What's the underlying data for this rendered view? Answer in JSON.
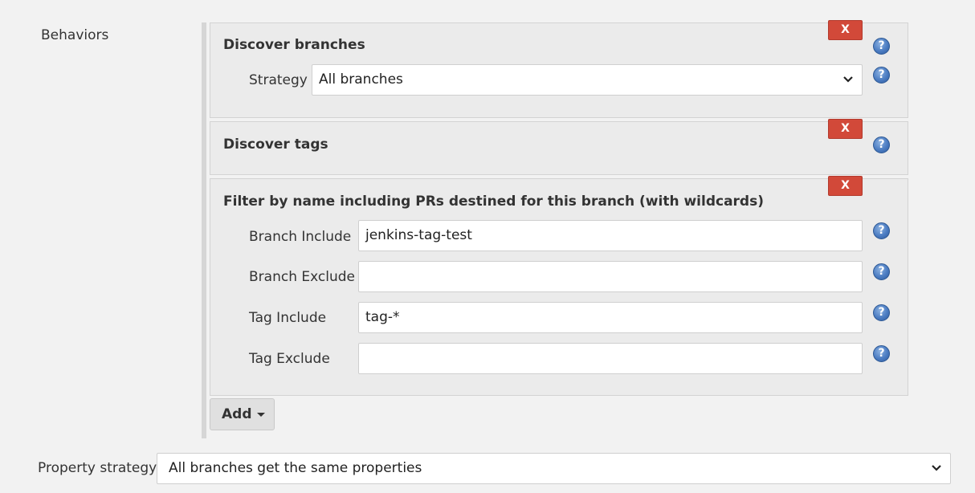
{
  "behaviors": {
    "label": "Behaviors",
    "discover_branches": {
      "title": "Discover branches",
      "remove_label": "X",
      "strategy_label": "Strategy",
      "strategy_value": "All branches"
    },
    "discover_tags": {
      "title": "Discover tags",
      "remove_label": "X"
    },
    "filter_by_name": {
      "title": "Filter by name including PRs destined for this branch (with wildcards)",
      "remove_label": "X",
      "fields": [
        {
          "label": "Branch Include",
          "value": "jenkins-tag-test"
        },
        {
          "label": "Branch Exclude",
          "value": ""
        },
        {
          "label": "Tag Include",
          "value": "tag-*"
        },
        {
          "label": "Tag Exclude",
          "value": ""
        }
      ]
    },
    "add_label": "Add",
    "help_glyph": "?"
  },
  "property_strategy": {
    "label": "Property strategy",
    "value": "All branches get the same properties"
  },
  "colors": {
    "remove_button": "#d24939",
    "help_icon": "#4b7cc2",
    "page_background": "#f2f2f2"
  },
  "icons": [
    "remove-x-icon",
    "help-icon",
    "chevron-down-icon",
    "caret-down-icon"
  ]
}
